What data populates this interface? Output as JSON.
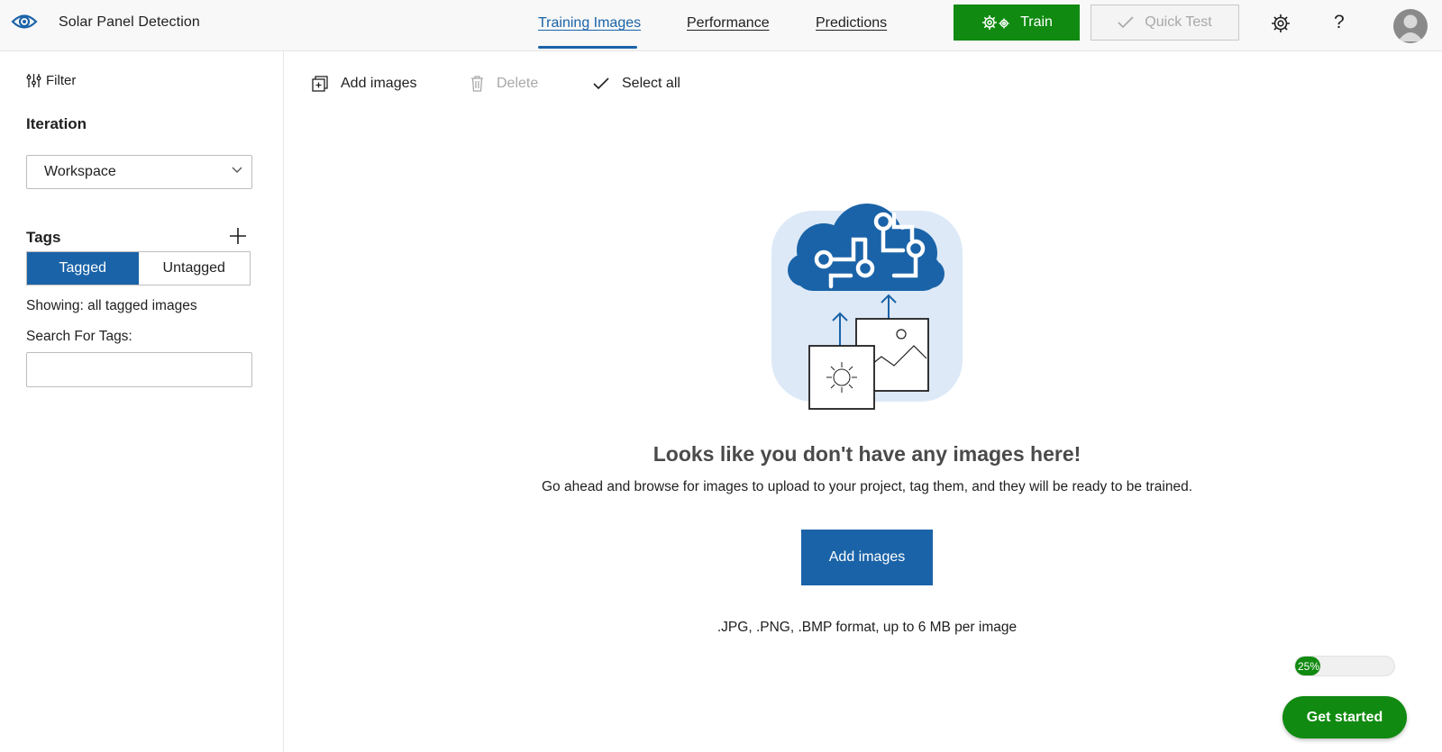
{
  "app": {
    "title": "Solar Panel Detection",
    "logo_icon": "eye-icon"
  },
  "nav": {
    "tabs": [
      {
        "label": "Training Images",
        "active": true
      },
      {
        "label": "Performance",
        "active": false
      },
      {
        "label": "Predictions",
        "active": false
      }
    ]
  },
  "header_actions": {
    "train_label": "Train",
    "train_icon": "gears-icon",
    "quick_test_label": "Quick Test",
    "quick_test_icon": "checkmark-icon",
    "settings_icon": "gear-icon",
    "help_label": "?",
    "avatar_icon": "user-avatar-icon"
  },
  "sidebar": {
    "filter_label": "Filter",
    "iteration_title": "Iteration",
    "iteration_value": "Workspace",
    "tags_title": "Tags",
    "toggle": {
      "tagged": "Tagged",
      "untagged": "Untagged",
      "selected": "Tagged"
    },
    "showing_text": "Showing: all tagged images",
    "search_label": "Search For Tags:",
    "search_value": ""
  },
  "toolbar": {
    "add_images": "Add images",
    "delete": "Delete",
    "select_all": "Select all"
  },
  "empty_state": {
    "title": "Looks like you don't have any images here!",
    "description": "Go ahead and browse for images to upload to your project, tag them, and they will be ready to be trained.",
    "button_label": "Add images",
    "format_note": ".JPG, .PNG, .BMP format, up to 6 MB per image"
  },
  "onboarding": {
    "progress_percent": 25,
    "progress_label": "25%",
    "get_started_label": "Get started"
  },
  "colors": {
    "accent_blue": "#1a63a8",
    "train_green": "#108a10",
    "header_bg": "#f8f8f8"
  }
}
